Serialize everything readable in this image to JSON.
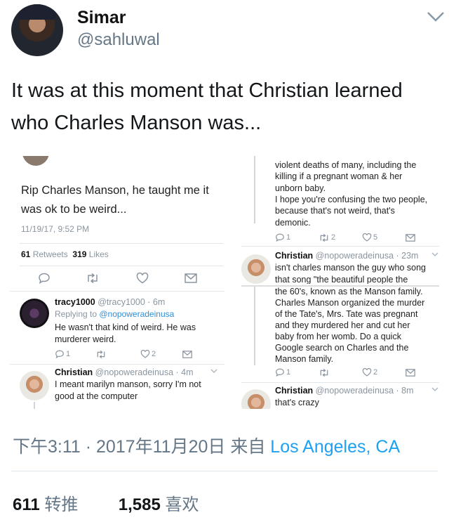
{
  "author": {
    "name": "Simar",
    "handle": "@sahluwal"
  },
  "tweet": {
    "text": "It was at this moment that Christian learned who Charles Manson was..."
  },
  "screenshot": {
    "left": {
      "main_text_line1": "Rip Charles Manson, he taught me it",
      "main_text_line2": "was ok to be weird...",
      "timestamp": "11/19/17, 9:52 PM",
      "retweets_count": "61",
      "retweets_label": "Retweets",
      "likes_count": "319",
      "likes_label": "Likes",
      "reply1": {
        "name": "tracy1000",
        "handle_time": "@tracy1000 · 6m",
        "replying_prefix": "Replying to ",
        "replying_handle": "@nopoweradeinusa",
        "line1": "He wasn't that kind of weird. He was",
        "line2": "murderer weird.",
        "retweet_count": "",
        "like_count": "2",
        "reply_count": "1"
      },
      "reply2": {
        "name": "Christian",
        "handle_time": "@nopoweradeinusa · 4m",
        "line1": "I meant marilyn manson, sorry I'm not",
        "line2": "good at the computer"
      }
    },
    "right": {
      "top_lines": [
        "violent deaths of many, including the",
        "killing if a pregnant woman & her",
        "unborn baby.",
        "I hope you're confusing the two people,",
        "because that's not weird, that's",
        "demonic."
      ],
      "top_actions": {
        "reply": "1",
        "retweet": "2",
        "like": "5"
      },
      "reply1": {
        "name": "Christian",
        "handle_time": "@nopoweradeinusa · 23m",
        "lines": [
          "isn't charles manson the guy who song",
          "that song \"the beautiful people the"
        ]
      },
      "middle_lines": [
        "the 60's, known as the Manson family.",
        "Charles Manson organized the murder",
        "of the Tate's, Mrs. Tate was pregnant",
        "and they murdered her and cut her",
        "baby from her womb. Do a quick",
        "Google search on Charles and the",
        "Manson family."
      ],
      "middle_actions": {
        "reply": "1",
        "like": "2"
      },
      "reply2": {
        "name": "Christian",
        "handle_time": "@nopoweradeinusa · 8m",
        "line1": "that's crazy"
      }
    }
  },
  "footer": {
    "time_prefix": "下午3:11 · 2017年11月20日 来自 ",
    "location": "Los Angeles, CA",
    "retweets_count": "611",
    "retweets_label": "转推",
    "likes_count": "1,585",
    "likes_label": "喜欢"
  },
  "colors": {
    "link": "#1da1f2",
    "secondary": "#657786",
    "text": "#14171a"
  }
}
